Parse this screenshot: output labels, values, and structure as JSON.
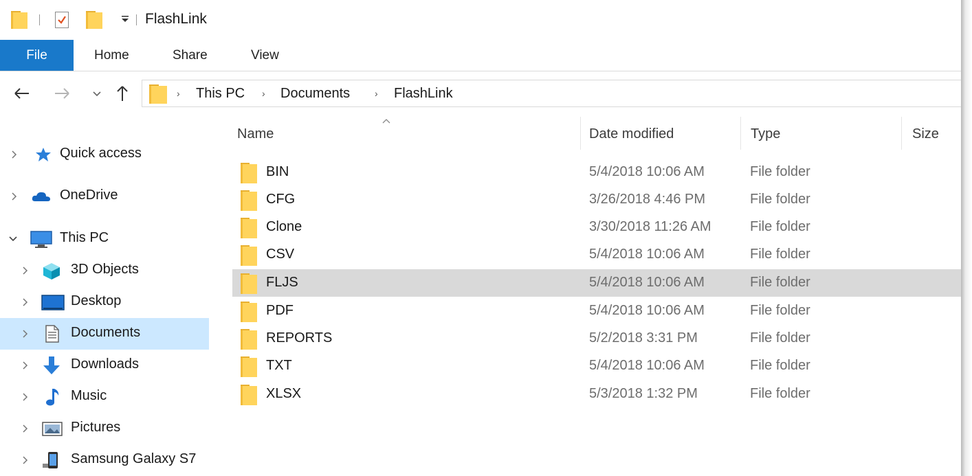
{
  "window": {
    "title": "FlashLink"
  },
  "ribbon": {
    "tabs": [
      {
        "label": "File"
      },
      {
        "label": "Home"
      },
      {
        "label": "Share"
      },
      {
        "label": "View"
      }
    ]
  },
  "address_bar": {
    "breadcrumbs": [
      "This PC",
      "Documents",
      "FlashLink"
    ]
  },
  "nav_pane": {
    "items": [
      {
        "label": "Quick access",
        "icon": "star-pin-icon"
      },
      {
        "label": "OneDrive",
        "icon": "cloud-icon"
      },
      {
        "label": "This PC",
        "icon": "computer-icon",
        "expanded": true
      },
      {
        "label": "3D Objects",
        "icon": "cube-icon"
      },
      {
        "label": "Desktop",
        "icon": "desktop-icon"
      },
      {
        "label": "Documents",
        "icon": "document-icon",
        "selected": true
      },
      {
        "label": "Downloads",
        "icon": "download-arrow-icon"
      },
      {
        "label": "Music",
        "icon": "music-note-icon"
      },
      {
        "label": "Pictures",
        "icon": "pictures-icon"
      },
      {
        "label": "Samsung Galaxy S7",
        "icon": "phone-icon"
      }
    ]
  },
  "file_list": {
    "columns": [
      "Name",
      "Date modified",
      "Type",
      "Size"
    ],
    "sorted_by": "Name",
    "rows": [
      {
        "name": "BIN",
        "date": "5/4/2018 10:06 AM",
        "type": "File folder"
      },
      {
        "name": "CFG",
        "date": "3/26/2018 4:46 PM",
        "type": "File folder"
      },
      {
        "name": "Clone",
        "date": "3/30/2018 11:26 AM",
        "type": "File folder"
      },
      {
        "name": "CSV",
        "date": "5/4/2018 10:06 AM",
        "type": "File folder"
      },
      {
        "name": "FLJS",
        "date": "5/4/2018 10:06 AM",
        "type": "File folder",
        "hovered": true
      },
      {
        "name": "PDF",
        "date": "5/4/2018 10:06 AM",
        "type": "File folder"
      },
      {
        "name": "REPORTS",
        "date": "5/2/2018 3:31 PM",
        "type": "File folder"
      },
      {
        "name": "TXT",
        "date": "5/4/2018 10:06 AM",
        "type": "File folder"
      },
      {
        "name": "XLSX",
        "date": "5/3/2018 1:32 PM",
        "type": "File folder"
      }
    ]
  },
  "colors": {
    "file_tab": "#1979ca",
    "selected_nav": "#cce8ff",
    "hover_row": "#d9d9d9",
    "folder": "#ffd45c",
    "folder_back": "#f2bc3a",
    "secondary_text": "#6d6d6d"
  }
}
